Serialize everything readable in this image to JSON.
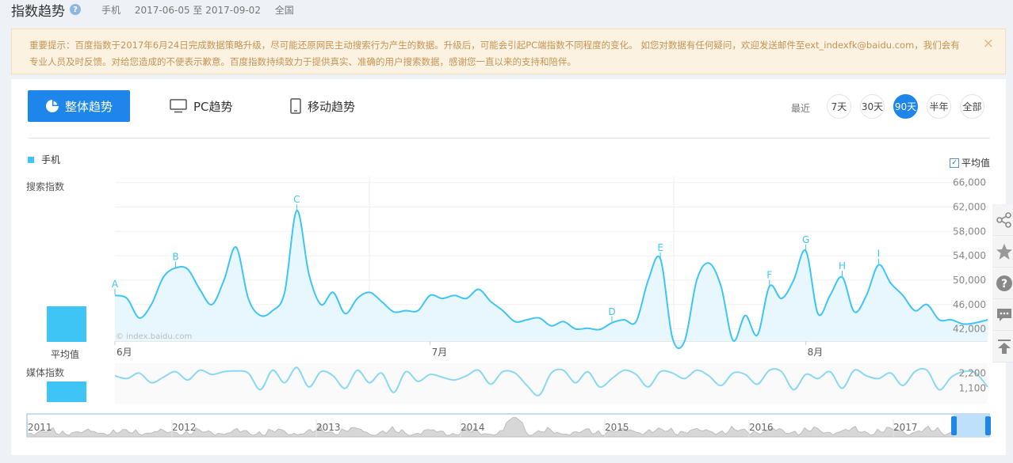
{
  "header": {
    "title": "指数趋势",
    "help_icon": "?",
    "device": "手机",
    "date_range": "2017-06-05 至 2017-09-02",
    "region": "全国"
  },
  "notice": {
    "text": "重要提示：百度指数于2017年6月24日完成数据策略升级，尽可能还原网民主动搜索行为产生的数据。升级后，可能会引起PC端指数不同程度的变化。 如您对数据有任何疑问，欢迎发送邮件至ext_indexfk@baidu.com，我们会有专业人员及时反馈。对给您造成的不便表示歉意。百度指数持续致力于提供真实、准确的用户搜索数据，感谢您一直以来的支持和陪伴。",
    "close_icon": "×"
  },
  "tabs": {
    "overall": "整体趋势",
    "pc": "PC趋势",
    "mobile": "移动趋势"
  },
  "range": {
    "label": "最近",
    "options": [
      "7天",
      "30天",
      "90天",
      "半年",
      "全部"
    ],
    "active": "90天"
  },
  "legend": {
    "series_name": "手机",
    "color": "#3ec5f5"
  },
  "avg_toggle": {
    "label": "平均值",
    "checked": true
  },
  "labels": {
    "search_index": "搜索指数",
    "average": "平均值",
    "media_index": "媒体指数",
    "watermark": "© index.baidu.com"
  },
  "chart_data": [
    {
      "type": "area",
      "series_name": "手机",
      "y_ticks": [
        "66,000",
        "62,000",
        "58,000",
        "54,000",
        "50,000",
        "46,000",
        "42,000"
      ],
      "ylim": [
        40000,
        67000
      ],
      "x_labels": [
        "6月",
        "7月",
        "8月"
      ],
      "annotations": [
        "A",
        "B",
        "C",
        "D",
        "E",
        "F",
        "G",
        "H",
        "I"
      ],
      "values": [
        47500,
        47000,
        43800,
        46000,
        50500,
        52000,
        51800,
        48500,
        46000,
        50000,
        55400,
        47000,
        44200,
        45000,
        48000,
        61400,
        51000,
        46000,
        48000,
        44500,
        47000,
        48000,
        46500,
        44800,
        45000,
        45000,
        47500,
        47000,
        47500,
        47000,
        48500,
        46500,
        45000,
        43200,
        43500,
        43800,
        42500,
        43200,
        42000,
        42100,
        41900,
        43000,
        43500,
        43200,
        50000,
        53500,
        40500,
        40000,
        50000,
        52800,
        49000,
        40100,
        44200,
        41000,
        49000,
        47000,
        50000,
        54800,
        44500,
        47500,
        50500,
        44800,
        47500,
        52500,
        49500,
        47500,
        45000,
        46000,
        43500,
        43500,
        42800,
        43000,
        43500
      ],
      "annotation_index": {
        "A": 0,
        "B": 5,
        "C": 15,
        "D": 41,
        "E": 45,
        "F": 54,
        "G": 57,
        "H": 60,
        "I": 63
      }
    },
    {
      "type": "line",
      "series_name": "媒体指数",
      "y_ticks": [
        "2,200",
        "1,100"
      ],
      "ylim": [
        0,
        2900
      ],
      "values": [
        2000,
        1800,
        2200,
        1500,
        1900,
        2300,
        1700,
        2400,
        2100,
        2300,
        2350,
        2200,
        1000,
        2400,
        1500,
        2600,
        1200,
        2300,
        2000,
        1100,
        2400,
        1500,
        2200,
        800,
        2300,
        1600,
        2100,
        1900,
        1700,
        2000,
        2400,
        1400,
        2300,
        2200,
        1300,
        600,
        2200,
        2400,
        1500,
        2300,
        1200,
        1800,
        2400,
        2100,
        1200,
        2300,
        2200,
        1800,
        2400,
        2000,
        1300,
        2200,
        2100,
        1400,
        2400,
        2300,
        1000,
        2100,
        1800,
        2300,
        1100,
        2400,
        2000,
        1800,
        2200,
        1300,
        2300,
        2400,
        1000,
        1900,
        2300,
        2200,
        1200
      ],
      "avg_line": 2200
    },
    {
      "type": "area",
      "series_name": "全部",
      "x_labels": [
        "2011",
        "2012",
        "2013",
        "2014",
        "2015",
        "2016",
        "2017"
      ]
    }
  ]
}
